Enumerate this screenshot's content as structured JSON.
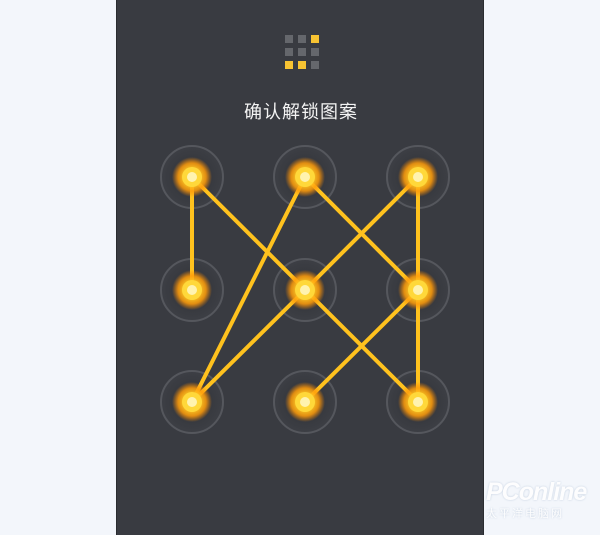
{
  "screen": {
    "prompt": "确认解锁图案",
    "pattern_dots": [
      {
        "id": 1,
        "row": 1,
        "col": 1,
        "selected": true
      },
      {
        "id": 2,
        "row": 1,
        "col": 2,
        "selected": true
      },
      {
        "id": 3,
        "row": 1,
        "col": 3,
        "selected": true
      },
      {
        "id": 4,
        "row": 2,
        "col": 1,
        "selected": true
      },
      {
        "id": 5,
        "row": 2,
        "col": 2,
        "selected": true
      },
      {
        "id": 6,
        "row": 2,
        "col": 3,
        "selected": true
      },
      {
        "id": 7,
        "row": 3,
        "col": 1,
        "selected": true
      },
      {
        "id": 8,
        "row": 3,
        "col": 2,
        "selected": true
      },
      {
        "id": 9,
        "row": 3,
        "col": 3,
        "selected": true
      }
    ],
    "pattern_path": [
      4,
      1,
      9,
      3,
      5,
      7,
      2,
      6,
      8
    ],
    "preview_grid_selected": [
      3,
      7,
      8
    ]
  },
  "watermark": {
    "brand": "PConline",
    "sub": "太平洋电脑网"
  },
  "colors": {
    "background": "#393b41",
    "accent": "#ffc21e",
    "glow": "#ff8a00",
    "text": "#f4f4f4"
  }
}
